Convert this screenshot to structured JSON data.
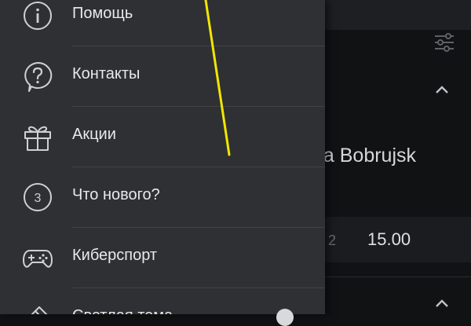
{
  "background": {
    "team_text": "na Bobrujsk",
    "odd_label": "2",
    "odd_value": "15.00"
  },
  "drawer": {
    "items": [
      {
        "label": "Помощь",
        "icon": "info-icon"
      },
      {
        "label": "Контакты",
        "icon": "question-bubble-icon"
      },
      {
        "label": "Акции",
        "icon": "gift-icon"
      },
      {
        "label": "Что нового?",
        "icon": "number-3-icon",
        "badge": "3"
      },
      {
        "label": "Киберспорт",
        "icon": "gamepad-icon"
      },
      {
        "label": "Светлая тема",
        "icon": "brush-icon",
        "control": "toggle"
      }
    ]
  },
  "colors": {
    "drawer_bg": "#2e3034",
    "background": "#111214",
    "annotation": "#f2e600"
  }
}
